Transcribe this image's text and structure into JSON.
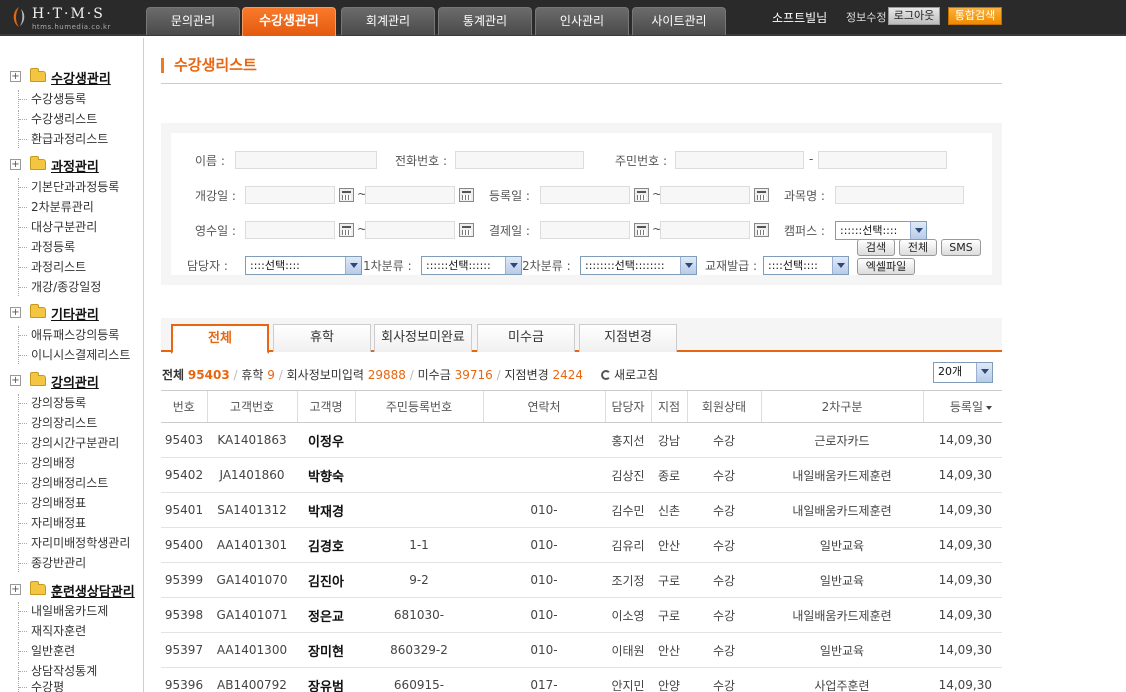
{
  "logo": {
    "text": "H·T·M·S",
    "sub": "htms.humedia.co.kr"
  },
  "nav": {
    "tabs": [
      {
        "label": "문의관리",
        "active": false
      },
      {
        "label": "수강생관리",
        "active": true
      },
      {
        "label": "회계관리",
        "active": false
      },
      {
        "label": "통계관리",
        "active": false
      },
      {
        "label": "인사관리",
        "active": false
      },
      {
        "label": "사이트관리",
        "active": false
      }
    ],
    "user_name": "소프트빌님",
    "edit_info": "정보수정",
    "logout": "로그아웃",
    "search_all": "통합검색"
  },
  "sidebar": {
    "groups": [
      {
        "label": "수강생관리",
        "items": [
          "수강생등록",
          "수강생리스트",
          "환급과정리스트"
        ]
      },
      {
        "label": "과정관리",
        "items": [
          "기본단과과정등록",
          "2차분류관리",
          "대상구분관리",
          "과정등록",
          "과정리스트",
          "개강/종강일정"
        ]
      },
      {
        "label": "기타관리",
        "items": [
          "애듀패스강의등록",
          "이니시스결제리스트"
        ]
      },
      {
        "label": "강의관리",
        "items": [
          "강의장등록",
          "강의장리스트",
          "강의시간구분관리",
          "강의배정",
          "강의배정리스트",
          "강의배정표",
          "자리배정표",
          "자리미배정학생관리",
          "종강반관리"
        ]
      },
      {
        "label": "훈련생상담관리",
        "items": [
          "내일배움카드제",
          "재직자훈련",
          "일반훈련",
          "상담작성통계",
          "수강평"
        ]
      }
    ]
  },
  "page_title": "수강생리스트",
  "search": {
    "name": "이름 :",
    "phone": "전화번호 :",
    "ssn": "주민번호 :",
    "ssn_dash": "-",
    "open_date": "개강일 :",
    "reg_date": "등록일 :",
    "subject": "과목명 :",
    "receipt_date": "영수일 :",
    "pay_date": "결제일 :",
    "campus": "캠퍼스 :",
    "campus_select": "::::::선택::::",
    "manager": "담당자 :",
    "manager_select": "::::선택::::",
    "cat1": "1차분류 :",
    "cat1_select": "::::::선택::::::",
    "cat2": "2차분류 :",
    "cat2_select": "::::::::선택::::::::",
    "textbook": "교재발급 :",
    "textbook_select": "::::선택::::",
    "tilde": "~",
    "btn_search": "검색",
    "btn_all": "전체",
    "btn_sms": "SMS",
    "btn_excel": "엑셀파일"
  },
  "tabs": [
    {
      "label": "전체",
      "active": true
    },
    {
      "label": "휴학",
      "active": false
    },
    {
      "label": "회사정보미완료",
      "active": false
    },
    {
      "label": "미수금",
      "active": false
    },
    {
      "label": "지점변경",
      "active": false
    }
  ],
  "summary": {
    "total_label": "전체",
    "total": "95403",
    "leave_label": "휴학",
    "leave": "9",
    "company_label": "회사정보미입력",
    "company": "29888",
    "unpaid_label": "미수금",
    "unpaid": "39716",
    "branch_label": "지점변경",
    "branch": "2424",
    "refresh": "새로고침",
    "page_size": "20개"
  },
  "table": {
    "columns": [
      "번호",
      "고객번호",
      "고객명",
      "주민등록번호",
      "연락처",
      "담당자",
      "지점",
      "회원상태",
      "2차구분",
      "등록일"
    ],
    "rows": [
      [
        "95403",
        "KA1401863",
        "이정우",
        "",
        "",
        "홍지선",
        "강남",
        "수강",
        "근로자카드",
        "14,09,30"
      ],
      [
        "95402",
        "JA1401860",
        "박향숙",
        "",
        "",
        "김상진",
        "종로",
        "수강",
        "내일배움카드제훈련",
        "14,09,30"
      ],
      [
        "95401",
        "SA1401312",
        "박재경",
        "",
        "010-",
        "김수민",
        "신촌",
        "수강",
        "내일배움카드제훈련",
        "14,09,30"
      ],
      [
        "95400",
        "AA1401301",
        "김경호",
        "1-1",
        "010-",
        "김유리",
        "안산",
        "수강",
        "일반교육",
        "14,09,30"
      ],
      [
        "95399",
        "GA1401070",
        "김진아",
        "9-2",
        "010-",
        "조기정",
        "구로",
        "수강",
        "일반교육",
        "14,09,30"
      ],
      [
        "95398",
        "GA1401071",
        "정은교",
        "681030-",
        "010-",
        "이소영",
        "구로",
        "수강",
        "내일배움카드제훈련",
        "14,09,30"
      ],
      [
        "95397",
        "AA1401300",
        "장미현",
        "860329-2",
        "010-",
        "이태원",
        "안산",
        "수강",
        "일반교육",
        "14,09,30"
      ],
      [
        "95396",
        "AB1400792",
        "장유범",
        "660915-",
        "017-",
        "안지민",
        "안양",
        "수강",
        "사업주훈련",
        "14,09,30"
      ]
    ]
  },
  "colors": {
    "accent": "#e8660f",
    "topbar": "#2a2a2a"
  }
}
